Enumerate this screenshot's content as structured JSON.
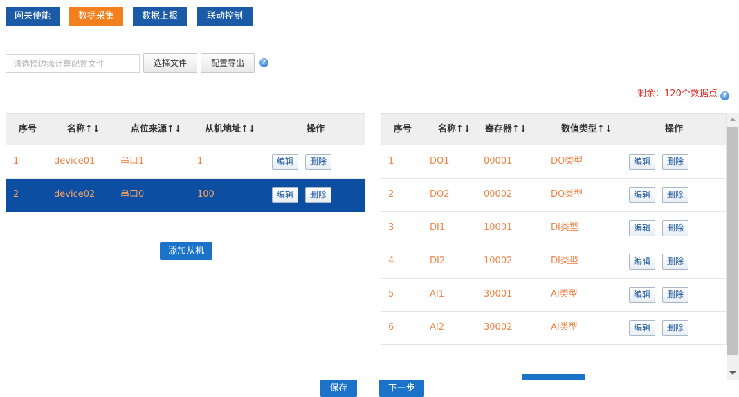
{
  "tabs": [
    {
      "label": "网关使能"
    },
    {
      "label": "数据采集"
    },
    {
      "label": "数据上报"
    },
    {
      "label": "联动控制"
    }
  ],
  "file": {
    "placeholder": "请选择边缘计算配置文件",
    "choose_label": "选择文件",
    "export_label": "配置导出",
    "help_icon": "?"
  },
  "remaining": "剩余：120个数据点",
  "slave_table": {
    "headers": [
      "序号",
      "名称↑↓",
      "点位来源↑↓",
      "从机地址↑↓",
      "操作"
    ],
    "rows": [
      {
        "index": "1",
        "name": "device01",
        "source": "串口1",
        "address": "1",
        "edit": "编辑",
        "delete": "删除"
      },
      {
        "index": "2",
        "name": "device02",
        "source": "串口0",
        "address": "100",
        "edit": "编辑",
        "delete": "删除"
      }
    ],
    "add_label": "添加从机"
  },
  "point_table": {
    "headers": [
      "序号",
      "名称↑↓",
      "寄存器↑↓",
      "数值类型↑↓",
      "操作"
    ],
    "rows": [
      {
        "index": "1",
        "name": "DO1",
        "register": "00001",
        "type": "DO类型",
        "edit": "编辑",
        "delete": "删除"
      },
      {
        "index": "2",
        "name": "DO2",
        "register": "00002",
        "type": "DO类型",
        "edit": "编辑",
        "delete": "删除"
      },
      {
        "index": "3",
        "name": "DI1",
        "register": "10001",
        "type": "DI类型",
        "edit": "编辑",
        "delete": "删除"
      },
      {
        "index": "4",
        "name": "DI2",
        "register": "10002",
        "type": "DI类型",
        "edit": "编辑",
        "delete": "删除"
      },
      {
        "index": "5",
        "name": "AI1",
        "register": "30001",
        "type": "AI类型",
        "edit": "编辑",
        "delete": "删除"
      },
      {
        "index": "6",
        "name": "AI2",
        "register": "30002",
        "type": "AI类型",
        "edit": "编辑",
        "delete": "删除"
      }
    ]
  },
  "footer": {
    "save_label": "保存",
    "next_label": "下一步"
  }
}
